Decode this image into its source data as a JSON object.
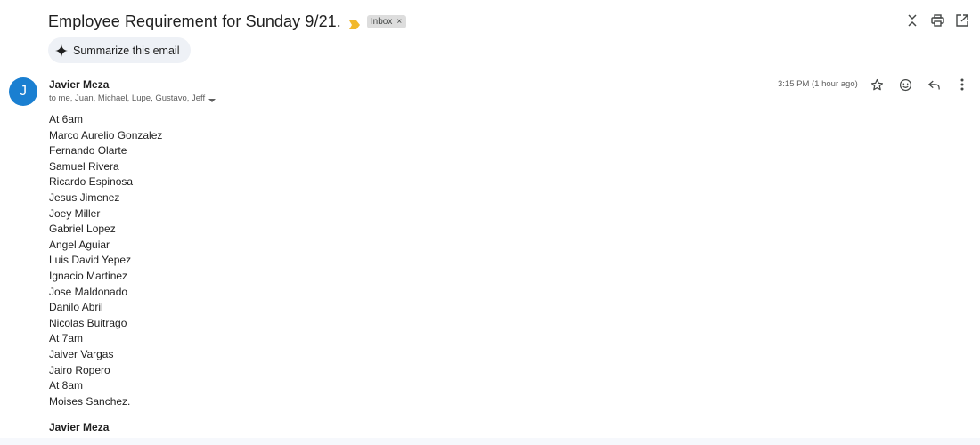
{
  "email": {
    "subject": "Employee Requirement for Sunday 9/21.",
    "label_chip": "Inbox",
    "label_chip_close": "×",
    "summarize_label": "Summarize this email",
    "avatar_letter": "J",
    "sender_name": "Javier Meza",
    "recipients": "to me, Juan, Michael, Lupe, Gustavo, Jeff",
    "timestamp": "3:15 PM (1 hour ago)",
    "body_lines": [
      "At 6am",
      "Marco Aurelio Gonzalez",
      "Fernando Olarte",
      "Samuel Rivera",
      "Ricardo Espinosa",
      "Jesus Jimenez",
      "Joey Miller",
      "Gabriel Lopez",
      "Angel Aguiar",
      "Luis David Yepez",
      "Ignacio Martinez",
      "Jose Maldonado",
      "Danilo Abril",
      "Nicolas Buitrago",
      "At 7am",
      "Jaiver Vargas",
      "Jairo Ropero",
      "At 8am",
      "Moises Sanchez."
    ],
    "signature": "Javier Meza"
  },
  "icons": {
    "importance": "importance-marker-icon",
    "collapse": "collapse-all-icon",
    "print": "print-icon",
    "new_window": "open-in-new-window-icon",
    "spark": "gemini-spark-icon",
    "star": "star-icon",
    "emoji": "emoji-react-icon",
    "reply": "reply-icon",
    "more": "more-vert-icon",
    "caret": "caret-down-icon"
  },
  "colors": {
    "avatar_bg": "#1a7fd1",
    "importance": "#f2b92c",
    "chip_bg": "#dddddd",
    "summarize_bg": "#eef1f6"
  }
}
